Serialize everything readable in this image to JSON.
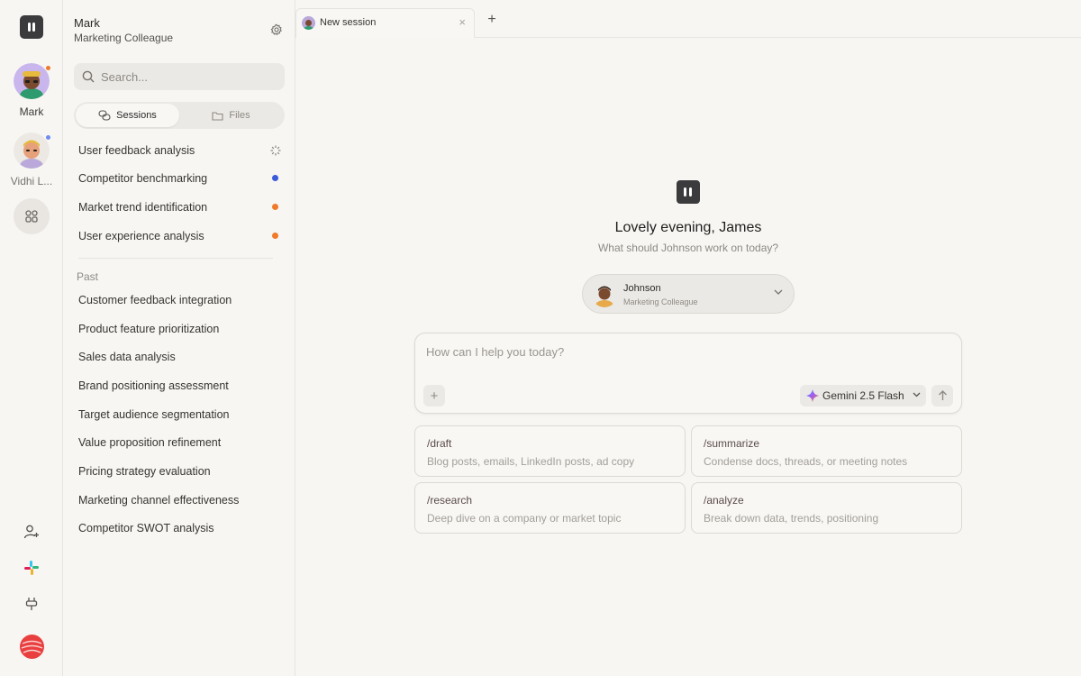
{
  "rail": {
    "agents": [
      {
        "name": "Mark",
        "status_color": "#f07a2c"
      },
      {
        "name": "Vidhi L...",
        "status_color": "#6f8cf2"
      }
    ]
  },
  "sidebar": {
    "workspace_name": "Mark",
    "workspace_role": "Marketing Colleague",
    "search": {
      "placeholder": "Search..."
    },
    "tabs": [
      {
        "label": "Sessions",
        "active": true
      },
      {
        "label": "Files",
        "active": false
      }
    ],
    "active_sessions": [
      {
        "title": "User feedback analysis",
        "status": "loading"
      },
      {
        "title": "Competitor benchmarking",
        "status": "blue",
        "color": "#3b5bdb"
      },
      {
        "title": "Market trend identification",
        "status": "orange",
        "color": "#f07a2c"
      },
      {
        "title": "User experience analysis",
        "status": "orange",
        "color": "#f07a2c"
      }
    ],
    "past_label": "Past",
    "past_sessions": [
      "Customer feedback integration",
      "Product feature prioritization",
      "Sales data analysis",
      "Brand positioning assessment",
      "Target audience segmentation",
      "Value proposition refinement",
      "Pricing strategy evaluation",
      "Marketing channel effectiveness",
      "Competitor SWOT analysis"
    ]
  },
  "tabbar": {
    "tab_label": "New session",
    "close_glyph": "×",
    "new_tab_glyph": "+"
  },
  "main": {
    "greeting": "Lovely evening, James",
    "subtitle": "What should Johnson work on today?",
    "agent": {
      "name": "Johnson",
      "role": "Marketing Colleague"
    },
    "composer": {
      "placeholder": "How can I help you today?",
      "add_glyph": "+",
      "model": "Gemini 2.5 Flash"
    },
    "commands": [
      {
        "cmd": "/draft",
        "desc": "Blog posts, emails, LinkedIn posts, ad copy"
      },
      {
        "cmd": "/summarize",
        "desc": "Condense docs, threads, or meeting notes"
      },
      {
        "cmd": "/research",
        "desc": "Deep dive on a company or market topic"
      },
      {
        "cmd": "/analyze",
        "desc": "Break down data, trends, positioning"
      }
    ]
  },
  "colors": {
    "accent_blue": "#3b5bdb",
    "accent_orange": "#f07a2c",
    "brand_red": "#e9403f"
  }
}
